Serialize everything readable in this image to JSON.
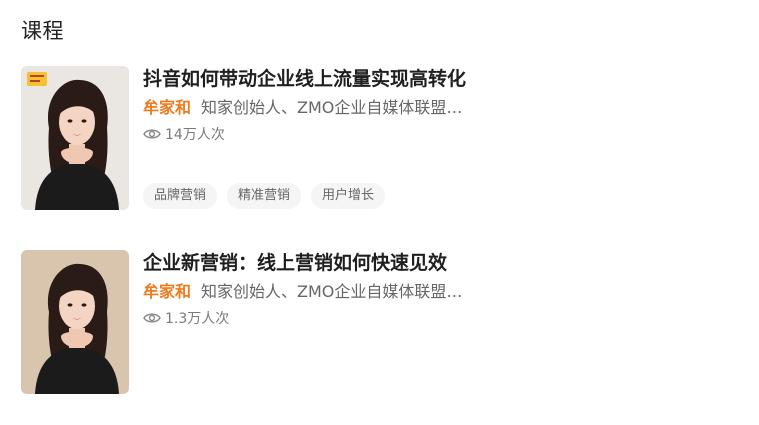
{
  "section": {
    "title": "课程"
  },
  "courses": [
    {
      "title": "抖音如何带动企业线上流量实现高转化",
      "author": "牟家和",
      "author_desc": "知家创始人、ZMO企业自媒体联盟…",
      "views": "14万人次",
      "tags": [
        "品牌营销",
        "精准营销",
        "用户增长"
      ],
      "thumb_bg": "#eae6e1"
    },
    {
      "title": "企业新营销：线上营销如何快速见效",
      "author": "牟家和",
      "author_desc": "知家创始人、ZMO企业自媒体联盟…",
      "views": "1.3万人次",
      "thumb_bg": "#d9c4ad"
    }
  ],
  "colors": {
    "author": "#f07b1e",
    "tag_bg": "#f5f5f5",
    "logo_badge": "#f2c233"
  }
}
